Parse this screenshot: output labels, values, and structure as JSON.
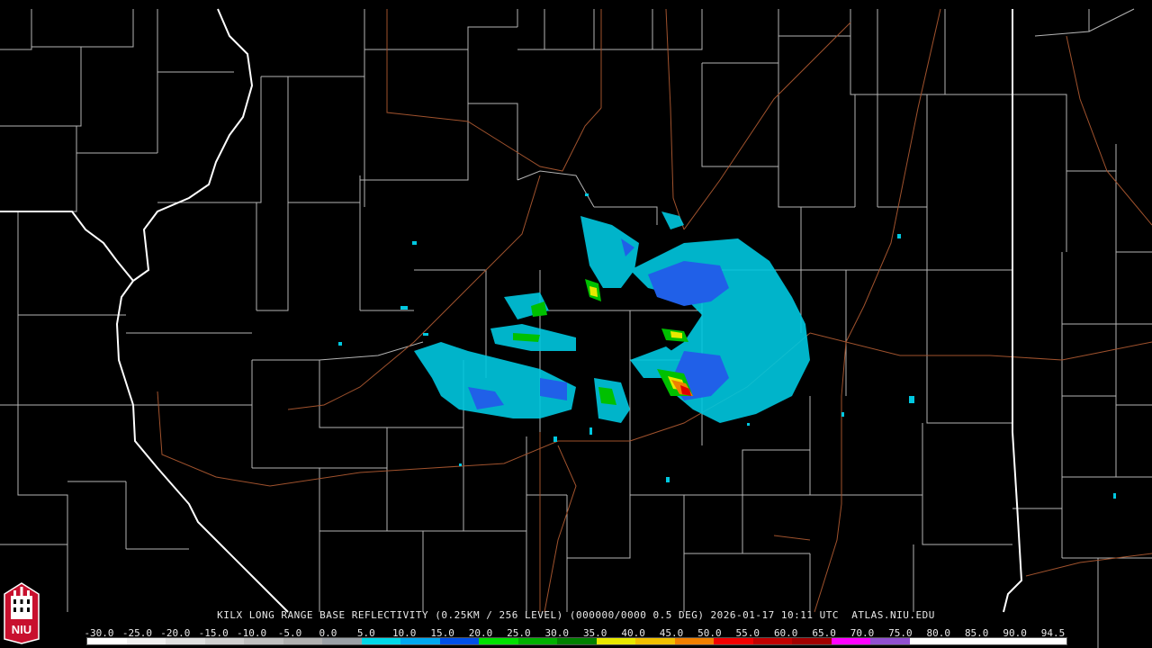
{
  "product": {
    "title": "KILX LONG RANGE BASE REFLECTIVITY (0.25KM / 256 LEVEL) (000000/0000 0.5 DEG) 2026-01-17 10:11 UTC  ATLAS.NIU.EDU"
  },
  "logo": {
    "text": "NIU",
    "icon": "niu-tower-logo",
    "colors": {
      "red": "#c8102e",
      "white": "#ffffff",
      "black": "#000000"
    }
  },
  "colorscale": {
    "labels": [
      "-30.0",
      "-25.0",
      "-20.0",
      "-15.0",
      "-10.0",
      "-5.0",
      "0.0",
      "5.0",
      "10.0",
      "15.0",
      "20.0",
      "25.0",
      "30.0",
      "35.0",
      "40.0",
      "45.0",
      "50.0",
      "55.0",
      "60.0",
      "65.0",
      "70.0",
      "75.0",
      "80.0",
      "85.0",
      "90.0",
      "94.5"
    ],
    "colors": [
      "#ffffff",
      "#f0f0f0",
      "#e0e0e0",
      "#d0d0d0",
      "#c0c0c0",
      "#b0b0b0",
      "#9aa0a6",
      "#00d8e8",
      "#00a8f0",
      "#0050e8",
      "#00e000",
      "#00b000",
      "#008000",
      "#e8e800",
      "#f0c000",
      "#f08000",
      "#f00000",
      "#c00000",
      "#a00000",
      "#ff00ff",
      "#9050d0",
      "#ffffff",
      "#ffffff",
      "#ffffff",
      "#ffffff"
    ]
  },
  "map": {
    "colors": {
      "background": "#000000",
      "county": "#b4b4b4",
      "state": "#ffffff",
      "highway": "#a0522d",
      "echo_light": "#00c8e0",
      "echo_blue": "#2060e8",
      "echo_green": "#00c000",
      "echo_yellow": "#e8e800",
      "echo_orange": "#f08000",
      "echo_red": "#e00000"
    }
  }
}
